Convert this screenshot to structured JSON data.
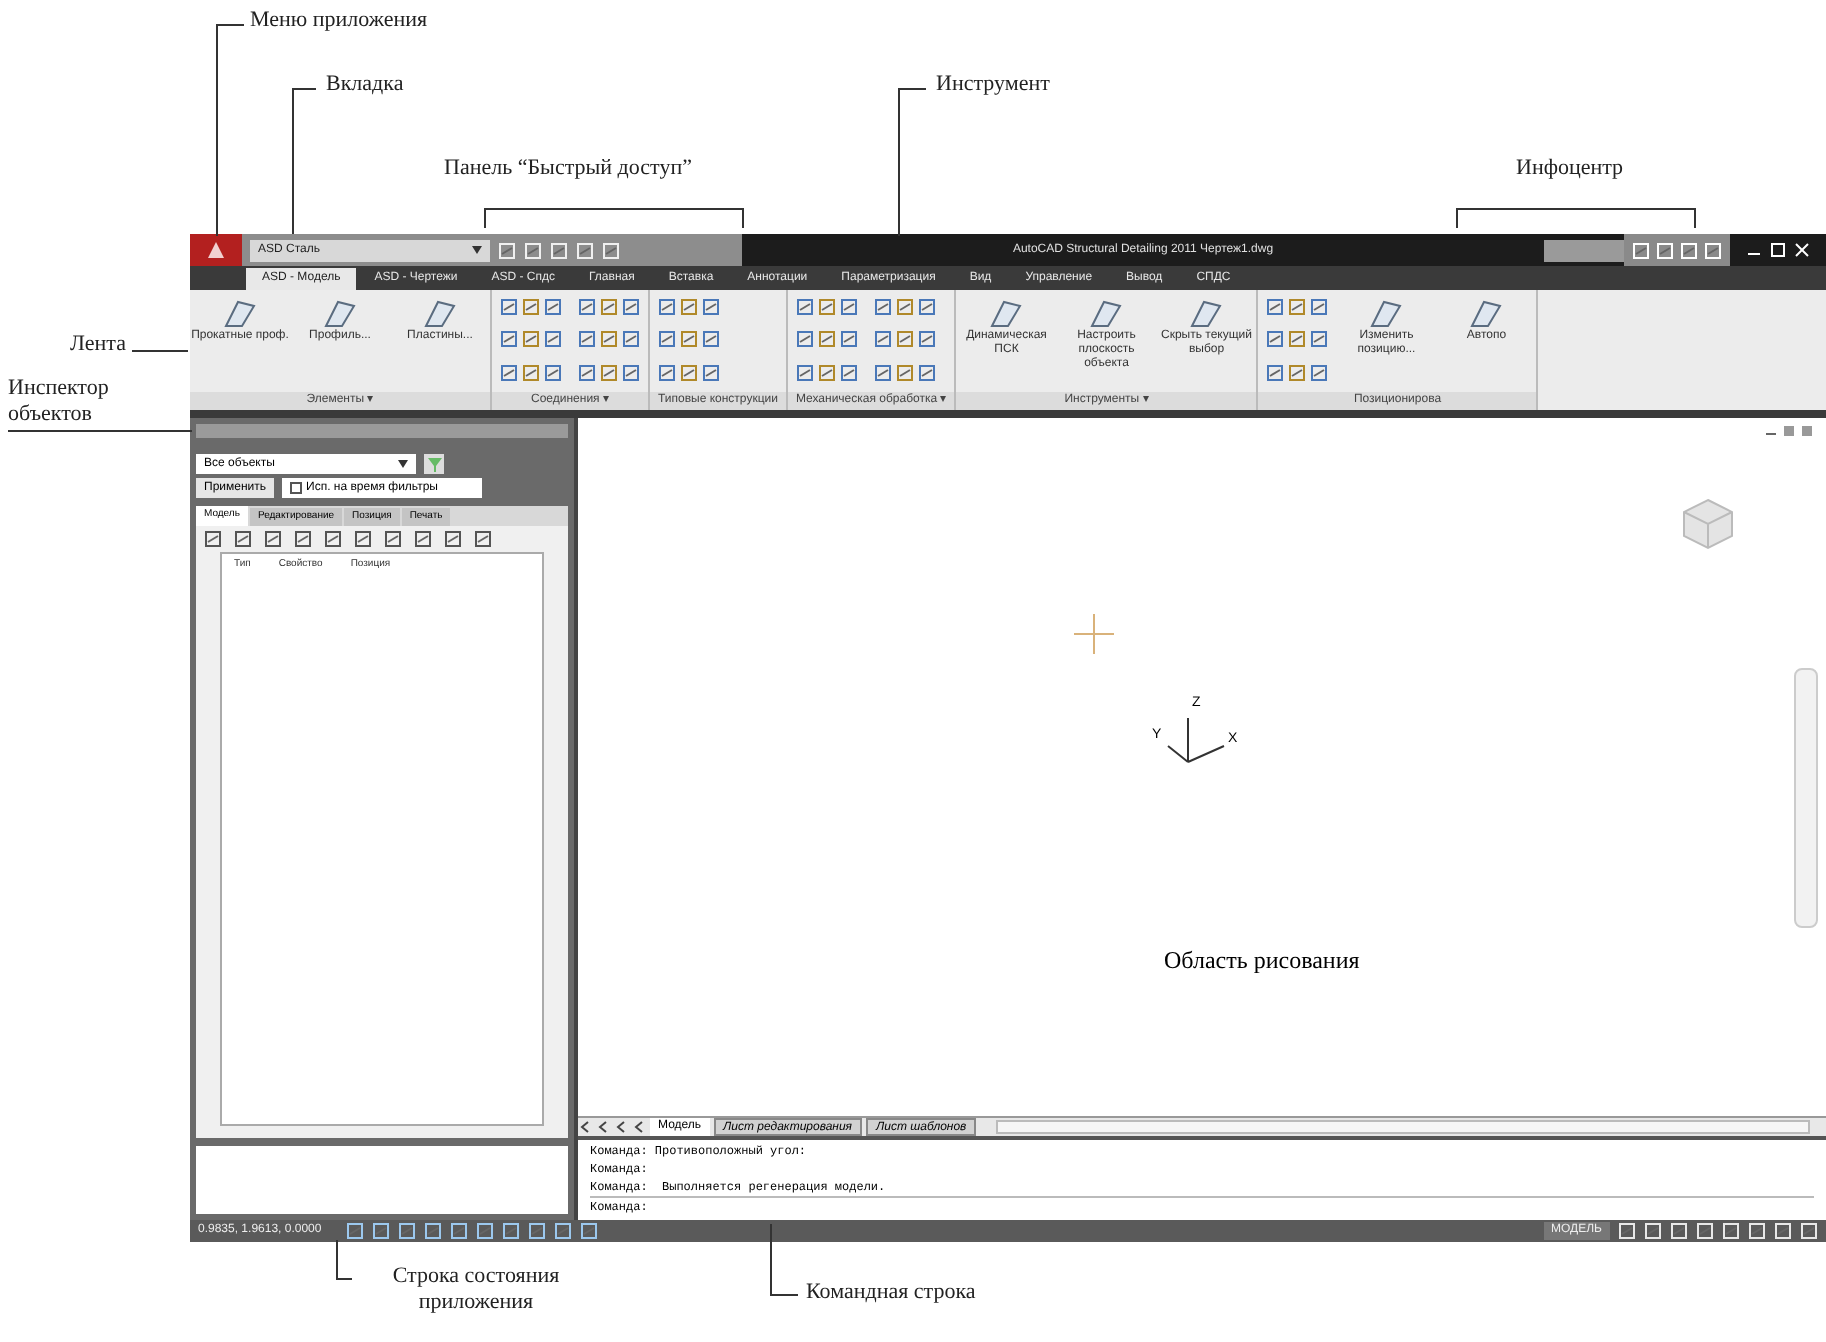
{
  "annotations": [
    {
      "text": "Меню приложения"
    },
    {
      "text": "Вкладка"
    },
    {
      "text": "Панель “Быстрый доступ”"
    },
    {
      "text": "Инструмент"
    },
    {
      "text": "Инфоцентр"
    },
    {
      "text": "Лента"
    },
    {
      "text": "Инспектор объектов"
    },
    {
      "text": "Область рисования"
    },
    {
      "text": "Строка состояния приложения"
    },
    {
      "text": "Командная строка"
    }
  ],
  "window": {
    "title": "AutoCAD Structural Detailing 2011   Чертеж1.dwg",
    "workspace": "ASD Сталь"
  },
  "ribbon": {
    "tabs": [
      {
        "label": "ASD - Модель",
        "selected": true
      },
      {
        "label": "ASD - Чертежи",
        "selected": false
      },
      {
        "label": "ASD - Спдс",
        "selected": false
      },
      {
        "label": "Главная",
        "selected": false
      },
      {
        "label": "Вставка",
        "selected": false
      },
      {
        "label": "Аннотации",
        "selected": false
      },
      {
        "label": "Параметризация",
        "selected": false
      },
      {
        "label": "Вид",
        "selected": false
      },
      {
        "label": "Управление",
        "selected": false
      },
      {
        "label": "Вывод",
        "selected": false
      },
      {
        "label": "СПДС",
        "selected": false
      }
    ],
    "panels": [
      {
        "title": "Элементы ▾",
        "tools": [
          {
            "kind": "large",
            "label": "Прокатные проф."
          },
          {
            "kind": "large",
            "label": "Профиль..."
          },
          {
            "kind": "large",
            "label": "Пластины..."
          }
        ]
      },
      {
        "title": "Соединения ▾",
        "tools": [
          {
            "kind": "icon_grid"
          },
          {
            "kind": "icon_grid"
          }
        ]
      },
      {
        "title": "Типовые конструкции",
        "tools": [
          {
            "kind": "icon_grid"
          }
        ]
      },
      {
        "title": "Механическая обработка ▾",
        "tools": [
          {
            "kind": "icon_grid"
          },
          {
            "kind": "icon_grid"
          }
        ]
      },
      {
        "title": "Инструменты ▾",
        "tools": [
          {
            "kind": "large",
            "label": "Динамическая ПСК"
          },
          {
            "kind": "large",
            "label": "Настроить плоскость объекта"
          },
          {
            "kind": "large",
            "label": "Скрыть текущий выбор"
          }
        ]
      },
      {
        "title": "Позиционирова",
        "tools": [
          {
            "kind": "icon_grid"
          },
          {
            "kind": "large",
            "label": "Изменить позицию..."
          },
          {
            "kind": "large",
            "label": "Автопо"
          }
        ]
      }
    ]
  },
  "inspector": {
    "filter": "Все объекты",
    "apply": "Применить",
    "temp_filter": {
      "label": "Исп. на время фильтры",
      "checked": false
    },
    "tabs": [
      {
        "label": "Модель",
        "selected": true
      },
      {
        "label": "Редактирование",
        "selected": false
      },
      {
        "label": "Позиция",
        "selected": false
      },
      {
        "label": "Печать",
        "selected": false
      }
    ],
    "columns": [
      "Тип",
      "Свойство",
      "Позиция"
    ]
  },
  "drawing": {
    "axes": [
      "Y",
      "Z",
      "X"
    ],
    "layout_tabs": [
      {
        "label": "Модель",
        "selected": true
      },
      {
        "label": "Лист редактирования",
        "selected": false
      },
      {
        "label": "Лист шаблонов",
        "selected": false
      }
    ]
  },
  "command_line": {
    "lines": [
      "Команда: Противоположный угол:",
      "Команда:",
      "Команда:  Выполняется регенерация модели."
    ],
    "prompt": "Команда:"
  },
  "status_bar": {
    "coordinates": "0.9835, 1.9613, 0.0000",
    "mode": "МОДЕЛЬ"
  }
}
